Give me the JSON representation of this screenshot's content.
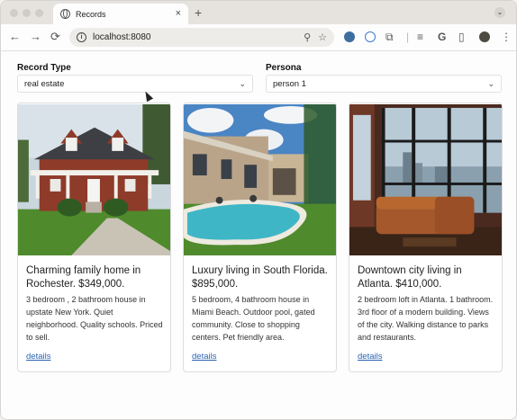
{
  "browser": {
    "tab_title": "Records",
    "tab_close": "×",
    "new_tab": "+",
    "url": "localhost:8080",
    "nav": {
      "back": "←",
      "forward": "→",
      "reload": "⟳"
    }
  },
  "filters": {
    "record_type": {
      "label": "Record Type",
      "value": "real estate"
    },
    "persona": {
      "label": "Persona",
      "value": "person 1"
    }
  },
  "cards": [
    {
      "title": "Charming family home in Rochester. $349,000.",
      "description": "3 bedroom , 2 bathroom house in upstate New York. Quiet neighborhood. Quality schools. Priced to sell.",
      "link": "details"
    },
    {
      "title": "Luxury living in South Florida. $895,000.",
      "description": "5 bedroom, 4 bathroom house in Miami Beach. Outdoor pool, gated community. Close to shopping centers. Pet friendly area.",
      "link": "details"
    },
    {
      "title": "Downtown city living in Atlanta. $410,000.",
      "description": "2 bedroom loft in Atlanta. 1 bathroom. 3rd floor of a modern building. Views of the city. Walking distance to parks and restaurants.",
      "link": "details"
    }
  ],
  "icons": [
    "globe-icon",
    "info-icon",
    "zoom-icon",
    "star-icon",
    "extensions-icon",
    "profile-avatar",
    "chevron-down-icon"
  ]
}
